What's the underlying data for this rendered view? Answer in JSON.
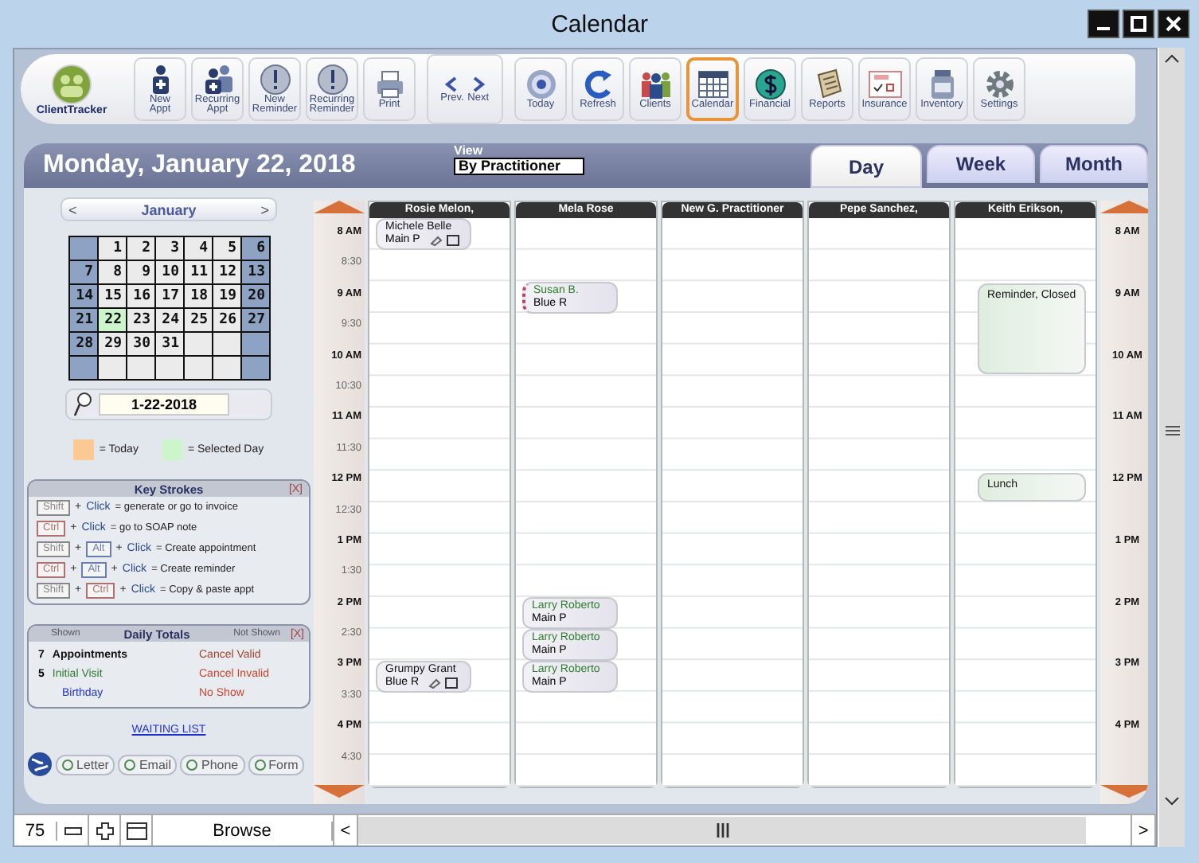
{
  "window": {
    "title": "Calendar"
  },
  "toolbar": [
    {
      "kind": "logo",
      "label": "ClientTracker"
    },
    {
      "kind": "button",
      "label": "New\nAppt",
      "selected": false
    },
    {
      "kind": "button",
      "label": "Recurring\nAppt",
      "selected": false
    },
    {
      "kind": "button",
      "label": "New\nReminder",
      "selected": false
    },
    {
      "kind": "button",
      "label": "Recurring\nReminder",
      "selected": false
    },
    {
      "kind": "button",
      "label": "Print",
      "selected": false
    },
    {
      "kind": "pager",
      "labels": [
        "Prev.",
        "Next"
      ]
    },
    {
      "kind": "button",
      "label": "Today",
      "selected": false
    },
    {
      "kind": "button",
      "label": "Refresh",
      "selected": false
    },
    {
      "kind": "button",
      "label": "Clients",
      "selected": false
    },
    {
      "kind": "button",
      "label": "Calendar",
      "selected": true
    },
    {
      "kind": "button",
      "label": "Financial",
      "selected": false
    },
    {
      "kind": "button",
      "label": "Reports",
      "selected": false
    },
    {
      "kind": "button",
      "label": "Insurance",
      "selected": false
    },
    {
      "kind": "button",
      "label": "Inventory",
      "selected": false
    },
    {
      "kind": "button",
      "label": "Settings",
      "selected": false
    }
  ],
  "header": {
    "date": "Monday, January 22, 2018",
    "view_label": "View",
    "view_value": "By Practitioner"
  },
  "tabs": [
    {
      "label": "Day",
      "selected": true
    },
    {
      "label": "Week",
      "selected": false
    },
    {
      "label": "Month",
      "selected": false
    }
  ],
  "mini_calendar": {
    "prev": "<",
    "month": "January",
    "next": ">",
    "weeks": [
      [
        {
          "day": "1",
          "selected": false
        },
        {
          "day": "2",
          "selected": false
        },
        {
          "day": "3",
          "selected": false
        },
        {
          "day": "4",
          "selected": false
        },
        {
          "day": "5",
          "selected": false
        },
        {
          "day": "6",
          "selected": false
        }
      ],
      [
        {
          "day": "7",
          "selected": false
        },
        {
          "day": "8",
          "selected": false
        },
        {
          "day": "9",
          "selected": false
        },
        {
          "day": "10",
          "selected": false
        },
        {
          "day": "11",
          "selected": false
        },
        {
          "day": "12",
          "selected": false
        },
        {
          "day": "13",
          "selected": false
        }
      ],
      [
        {
          "day": "14",
          "selected": false
        },
        {
          "day": "15",
          "selected": false
        },
        {
          "day": "16",
          "selected": false
        },
        {
          "day": "17",
          "selected": false
        },
        {
          "day": "18",
          "selected": false
        },
        {
          "day": "19",
          "selected": false
        },
        {
          "day": "20",
          "selected": false
        }
      ],
      [
        {
          "day": "21",
          "selected": false
        },
        {
          "day": "22",
          "selected": true
        },
        {
          "day": "23",
          "selected": false
        },
        {
          "day": "24",
          "selected": false
        },
        {
          "day": "25",
          "selected": false
        },
        {
          "day": "26",
          "selected": false
        },
        {
          "day": "27",
          "selected": false
        }
      ],
      [
        {
          "day": "28",
          "selected": false
        },
        {
          "day": "29",
          "selected": false
        },
        {
          "day": "30",
          "selected": false
        },
        {
          "day": "31",
          "selected": false
        }
      ]
    ],
    "date_field": "1-22-2018"
  },
  "legend": [
    {
      "label": "= Today",
      "color": "#fcc994"
    },
    {
      "label": "= Selected Day",
      "color": "#ccf5cc"
    }
  ],
  "key_strokes": {
    "title": "Key Strokes",
    "close": "[X]",
    "rows": [
      [
        {
          "kind": "key",
          "text": "Shift",
          "color": "#888888"
        },
        {
          "kind": "plus",
          "text": "+"
        },
        {
          "kind": "click",
          "text": "Click"
        },
        {
          "kind": "desc",
          "text": "= generate or go to invoice"
        }
      ],
      [
        {
          "kind": "key",
          "text": "Ctrl",
          "color": "#b07070"
        },
        {
          "kind": "plus",
          "text": "+"
        },
        {
          "kind": "click",
          "text": "Click"
        },
        {
          "kind": "desc",
          "text": "= go to SOAP note"
        }
      ],
      [
        {
          "kind": "key",
          "text": "Shift",
          "color": "#888888"
        },
        {
          "kind": "plus",
          "text": "+"
        },
        {
          "kind": "key",
          "text": "Alt",
          "color": "#6a7fb0"
        },
        {
          "kind": "plus",
          "text": "+"
        },
        {
          "kind": "click",
          "text": "Click"
        },
        {
          "kind": "desc",
          "text": "= Create appointment"
        }
      ],
      [
        {
          "kind": "key",
          "text": "Ctrl",
          "color": "#b07070"
        },
        {
          "kind": "plus",
          "text": "+"
        },
        {
          "kind": "key",
          "text": "Alt",
          "color": "#6a7fb0"
        },
        {
          "kind": "plus",
          "text": "+"
        },
        {
          "kind": "click",
          "text": "Click"
        },
        {
          "kind": "desc",
          "text": "= Create reminder"
        }
      ],
      [
        {
          "kind": "key",
          "text": "Shift",
          "color": "#888888"
        },
        {
          "kind": "plus",
          "text": "+"
        },
        {
          "kind": "key",
          "text": "Ctrl",
          "color": "#b07070"
        },
        {
          "kind": "plus",
          "text": "+"
        },
        {
          "kind": "click",
          "text": "Click"
        },
        {
          "kind": "desc",
          "text": "= Copy & paste appt"
        }
      ]
    ]
  },
  "daily_totals": {
    "shown": "Shown",
    "title": "Daily Totals",
    "not_shown": "Not Shown",
    "close": "[X]",
    "left": [
      {
        "count": "7",
        "label": "Appointments",
        "color": "#111111"
      },
      {
        "count": "5",
        "label": "Initial Visit",
        "color": "#2e7d2e"
      },
      {
        "label": "Birthday",
        "color": "#2233cc"
      }
    ],
    "right": [
      {
        "label": "Cancel Valid",
        "color": "#a0432a"
      },
      {
        "label": "Cancel Invalid",
        "color": "#c8452a"
      },
      {
        "label": "No Show",
        "color": "#c8452a"
      }
    ]
  },
  "waiting_list": "WAITING LIST",
  "bottom_tabs": [
    "Letter",
    "Email",
    "Phone",
    "Form"
  ],
  "left_times": [
    {
      "label": "8 AM",
      "kind": "hour"
    },
    {
      "label": "8:30",
      "kind": "half"
    },
    {
      "label": "9 AM",
      "kind": "hour"
    },
    {
      "label": "9:30",
      "kind": "half"
    },
    {
      "label": "10 AM",
      "kind": "hour"
    },
    {
      "label": "10:30",
      "kind": "half"
    },
    {
      "label": "11 AM",
      "kind": "hour"
    },
    {
      "label": "11:30",
      "kind": "half"
    },
    {
      "label": "12 PM",
      "kind": "hour"
    },
    {
      "label": "12:30",
      "kind": "half"
    },
    {
      "label": "1 PM",
      "kind": "hour"
    },
    {
      "label": "1:30",
      "kind": "half"
    },
    {
      "label": "2 PM",
      "kind": "hour"
    },
    {
      "label": "2:30",
      "kind": "half"
    },
    {
      "label": "3 PM",
      "kind": "hour"
    },
    {
      "label": "3:30",
      "kind": "half"
    },
    {
      "label": "4 PM",
      "kind": "hour"
    },
    {
      "label": "4:30",
      "kind": "half"
    }
  ],
  "right_times": [
    "8 AM",
    "9 AM",
    "10 AM",
    "11 AM",
    "12 PM",
    "1 PM",
    "2 PM",
    "3 PM",
    "4 PM"
  ],
  "practitioners": [
    {
      "name": "Rosie Melon,",
      "slots": [
        {
          "kind": "appointment",
          "name": "Michele Belle",
          "color": "#111111",
          "detail": "Main P",
          "note_icons": true,
          "flagged": false
        },
        {
          "kind": "free"
        },
        {
          "kind": "free"
        },
        {
          "kind": "free"
        },
        {
          "kind": "free"
        },
        {
          "kind": "free"
        },
        {
          "kind": "free"
        },
        {
          "kind": "free"
        },
        {
          "kind": "free"
        },
        {
          "kind": "free"
        },
        {
          "kind": "free"
        },
        {
          "kind": "free"
        },
        {
          "kind": "free"
        },
        {
          "kind": "free"
        },
        {
          "kind": "appointment",
          "name": "Grumpy Grant",
          "color": "#111111",
          "detail": "Blue R",
          "note_icons": true,
          "flagged": false
        }
      ]
    },
    {
      "name": "Mela Rose",
      "slots": [
        {
          "kind": "free"
        },
        {
          "kind": "free"
        },
        {
          "kind": "appointment",
          "name": "Susan B.",
          "color": "#2e7d2e",
          "detail": "Blue R",
          "note_icons": false,
          "flagged": true
        },
        {
          "kind": "free"
        },
        {
          "kind": "free"
        },
        {
          "kind": "free"
        },
        {
          "kind": "free"
        },
        {
          "kind": "free"
        },
        {
          "kind": "free"
        },
        {
          "kind": "free"
        },
        {
          "kind": "free"
        },
        {
          "kind": "free"
        },
        {
          "kind": "appointment",
          "name": "Larry Roberto",
          "color": "#2e7d2e",
          "detail": "Main P",
          "note_icons": false,
          "flagged": false
        },
        {
          "kind": "appointment",
          "name": "Larry Roberto",
          "color": "#2e7d2e",
          "detail": "Main P",
          "note_icons": false,
          "flagged": false
        },
        {
          "kind": "appointment",
          "name": "Larry Roberto",
          "color": "#2e7d2e",
          "detail": "Main P",
          "note_icons": false,
          "flagged": false
        }
      ]
    },
    {
      "name": "New G. Practitioner"
    },
    {
      "name": "Pepe Sanchez,"
    },
    {
      "name": "Keith Erikson,",
      "slots": [
        {
          "kind": "free"
        },
        {
          "kind": "free"
        },
        {
          "kind": "reminder",
          "text": "Reminder, Closed"
        },
        {
          "kind": "continued"
        },
        {
          "kind": "continued"
        },
        {
          "kind": "free"
        },
        {
          "kind": "free"
        },
        {
          "kind": "free"
        },
        {
          "kind": "reminder",
          "text": "Lunch"
        }
      ]
    }
  ],
  "status_bar": {
    "zoom": "75",
    "mode": "Browse",
    "left_arrow": "<",
    "right_arrow": ">"
  }
}
